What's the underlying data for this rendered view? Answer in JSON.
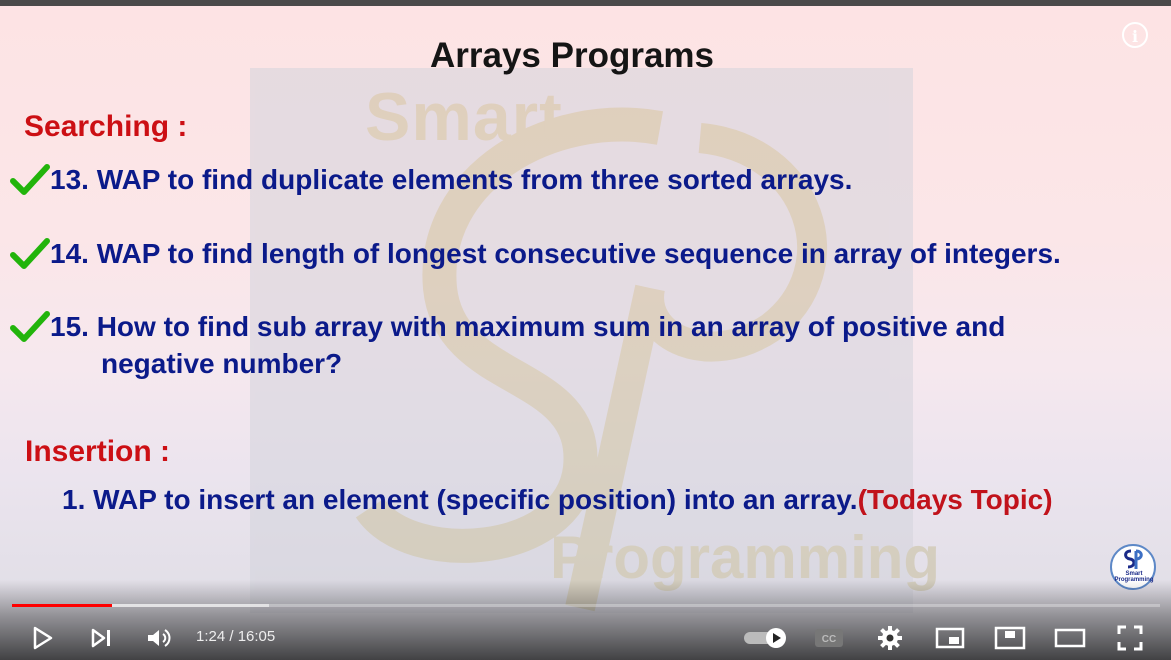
{
  "slide": {
    "title": "Arrays Programs",
    "watermark_top": "Smart",
    "watermark_bottom": "Programming",
    "section1": "Searching :",
    "items": [
      {
        "text": "13. WAP to find duplicate elements from three sorted arrays.",
        "checked": true
      },
      {
        "text": "14. WAP to find length of longest consecutive sequence in array of integers.",
        "checked": true
      },
      {
        "text": "15. How to find sub array with maximum sum in an array of positive and",
        "continuation": "negative number?",
        "checked": true
      }
    ],
    "section2": "Insertion :",
    "insertion_item": "1. WAP to insert an element (specific position) into an array.",
    "todays_topic": "(Todays Topic)",
    "brand_badge": "Smart Programming"
  },
  "player": {
    "time_current": "1:24",
    "time_total": "16:05",
    "time_display": "1:24 / 16:05",
    "progress_fraction": 0.087,
    "buffer_fraction": 0.224,
    "autoplay_on": true,
    "icons": [
      "play-icon",
      "next-icon",
      "volume-icon",
      "autoplay-toggle-icon",
      "captions-icon",
      "settings-icon",
      "miniplayer-icon",
      "theater-icon",
      "fullscreen-icon",
      "info-icon"
    ],
    "colors": {
      "progress": "#ff0000",
      "title": "#151515",
      "section": "#cc0f14",
      "item": "#0b1a8a",
      "check": "#22b40b"
    }
  }
}
